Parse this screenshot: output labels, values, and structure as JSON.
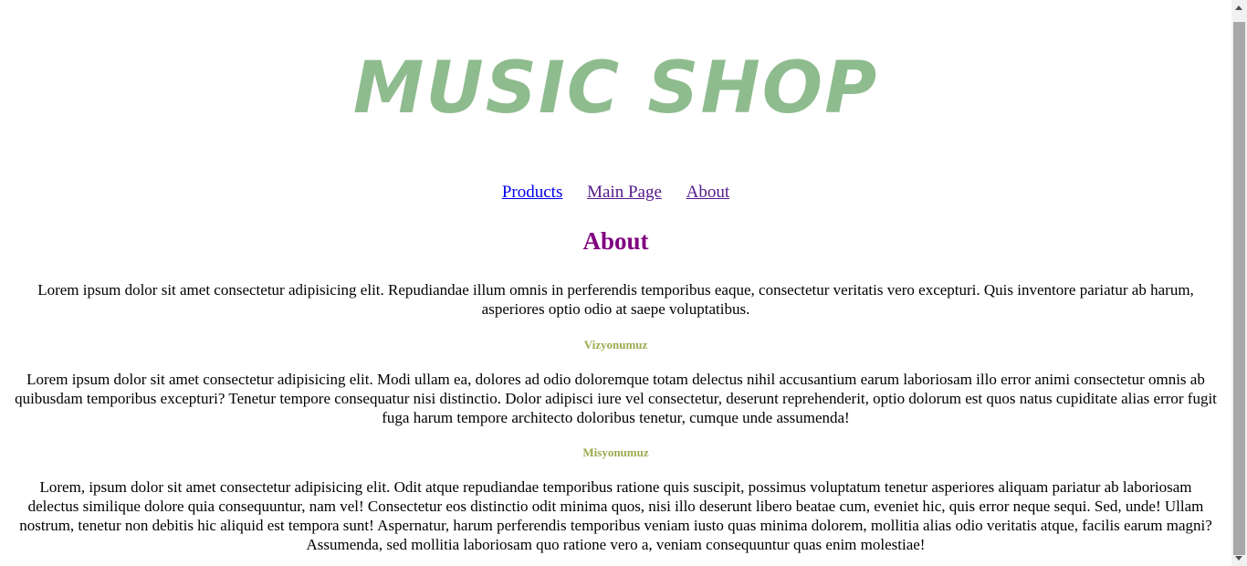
{
  "header": {
    "logo_text": "MUSIC SHOP",
    "logo_color": "#8fbc8f"
  },
  "nav": {
    "items": [
      {
        "label": "Products"
      },
      {
        "label": "Main Page"
      },
      {
        "label": "About"
      }
    ],
    "link_color": "#0000ee",
    "visited_color": "#551a8b"
  },
  "main": {
    "title": "About",
    "title_color": "#800080",
    "intro": "Lorem ipsum dolor sit amet consectetur adipisicing elit. Repudiandae illum omnis in perferendis temporibus eaque, consectetur veritatis vero excepturi. Quis inventore pariatur ab harum, asperiores optio odio at saepe voluptatibus.",
    "sections": [
      {
        "heading": "Vizyonumuz",
        "text": "Lorem ipsum dolor sit amet consectetur adipisicing elit. Modi ullam ea, dolores ad odio doloremque totam delectus nihil accusantium earum laboriosam illo error animi consectetur omnis ab quibusdam temporibus excepturi? Tenetur tempore consequatur nisi distinctio. Dolor adipisci iure vel consectetur, deserunt reprehenderit, optio dolorum est quos natus cupiditate alias error fugit fuga harum tempore architecto doloribus tenetur, cumque unde assumenda!"
      },
      {
        "heading": "Misyonumuz",
        "text": "Lorem, ipsum dolor sit amet consectetur adipisicing elit. Odit atque repudiandae temporibus ratione quis suscipit, possimus voluptatum tenetur asperiores aliquam pariatur ab laboriosam delectus similique dolore quia consequuntur, nam vel! Consectetur eos distinctio odit minima quos, nisi illo deserunt libero beatae cum, eveniet hic, quis error neque sequi. Sed, unde! Ullam nostrum, tenetur non debitis hic aliquid est tempora sunt! Aspernatur, harum perferendis temporibus veniam iusto quas minima dolorem, mollitia alias odio veritatis atque, facilis earum magni? Assumenda, sed mollitia laboriosam quo ratione vero a, veniam consequuntur quas enim molestiae!"
      }
    ],
    "heading_color": "#9aab4f"
  }
}
